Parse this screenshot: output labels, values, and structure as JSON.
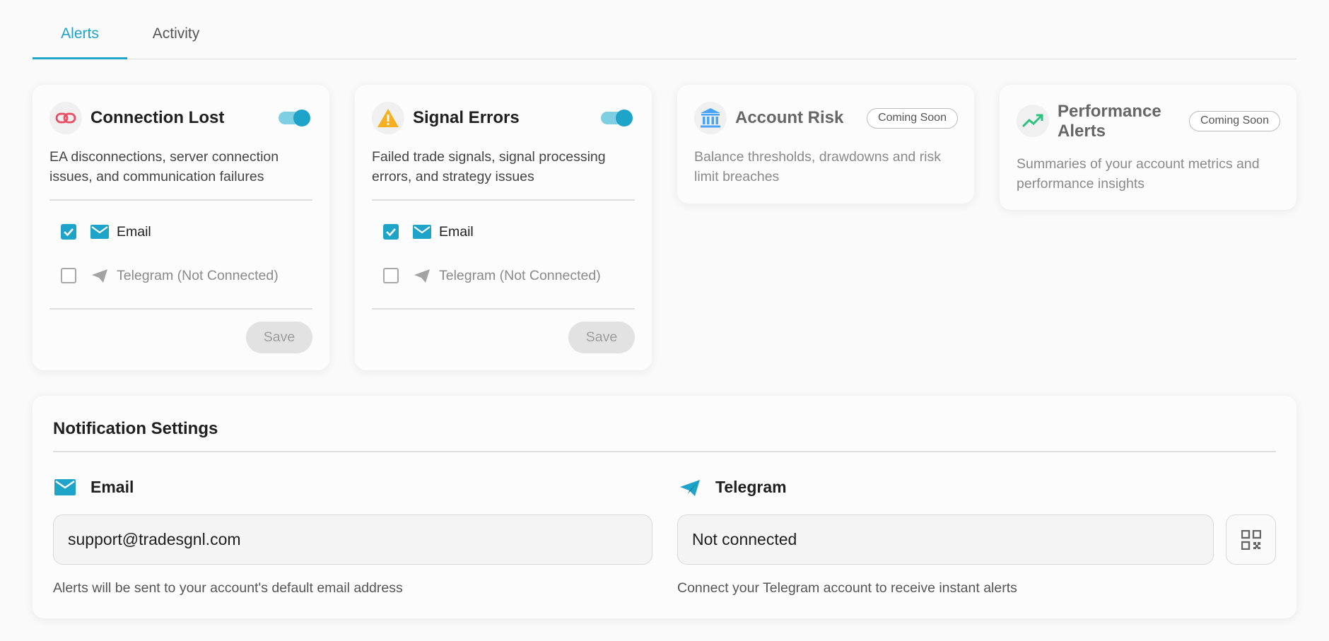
{
  "tabs": [
    {
      "label": "Alerts",
      "active": true
    },
    {
      "label": "Activity",
      "active": false
    }
  ],
  "colors": {
    "accent": "#1ea3c9",
    "link_icon": "#e94f64",
    "warning_icon": "#f5b021",
    "bank_icon": "#4aa3f5",
    "chart_icon": "#2ec27e",
    "muted_button": "#e2e2e2"
  },
  "cards": {
    "connection_lost": {
      "icon": "link-icon",
      "title": "Connection Lost",
      "enabled": true,
      "description": "EA disconnections, server connection issues, and communication failures",
      "email_label": "Email",
      "email_checked": true,
      "telegram_label": "Telegram (Not Connected)",
      "telegram_checked": false,
      "save_label": "Save"
    },
    "signal_errors": {
      "icon": "warning-icon",
      "title": "Signal Errors",
      "enabled": true,
      "description": "Failed trade signals, signal processing errors, and strategy issues",
      "email_label": "Email",
      "email_checked": true,
      "telegram_label": "Telegram (Not Connected)",
      "telegram_checked": false,
      "save_label": "Save"
    },
    "account_risk": {
      "icon": "bank-icon",
      "title": "Account Risk",
      "badge": "Coming Soon",
      "description": "Balance thresholds, drawdowns and risk limit breaches"
    },
    "performance_alerts": {
      "icon": "trending-up-icon",
      "title": "Performance Alerts",
      "badge": "Coming Soon",
      "description": "Summaries of your account metrics and performance insights"
    }
  },
  "notification_settings": {
    "title": "Notification Settings",
    "email": {
      "label": "Email",
      "value": "support@tradesgnl.com",
      "helper": "Alerts will be sent to your account's default email address"
    },
    "telegram": {
      "label": "Telegram",
      "value": "Not connected",
      "helper": "Connect your Telegram account to receive instant alerts",
      "qr_icon": "qr-code-icon"
    }
  }
}
